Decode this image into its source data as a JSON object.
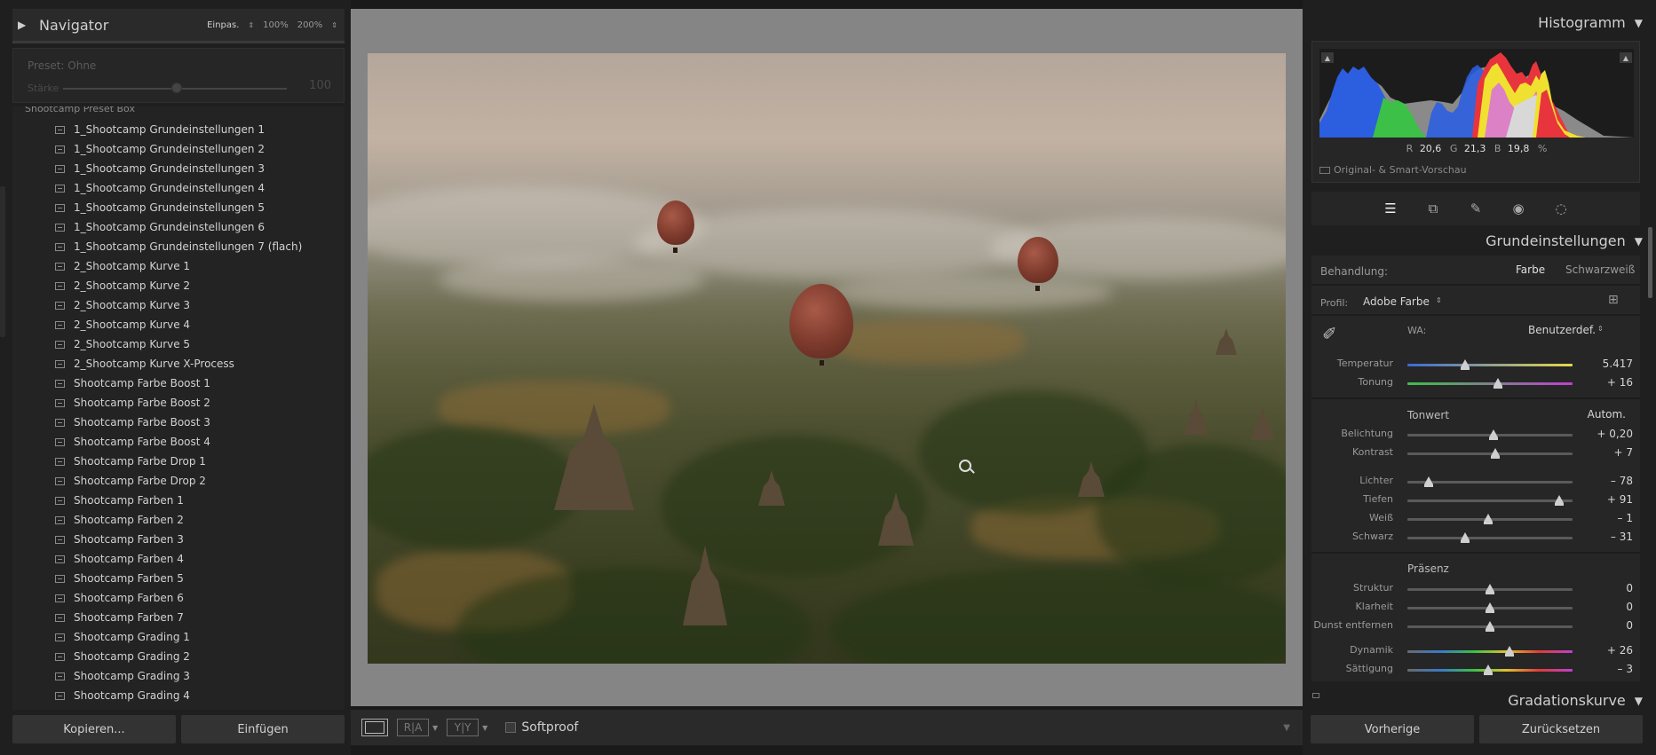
{
  "navigator": {
    "title": "Navigator",
    "zoom_options": [
      "Einpas.",
      "100%",
      "200%"
    ]
  },
  "preset_box": {
    "preset_label": "Preset: Ohne",
    "strength_label": "Stärke",
    "strength_value": "100"
  },
  "presets": {
    "folder": "Shootcamp Preset Box",
    "items": [
      "1_Shootcamp Grundeinstellungen 1",
      "1_Shootcamp Grundeinstellungen 2",
      "1_Shootcamp Grundeinstellungen 3",
      "1_Shootcamp Grundeinstellungen 4",
      "1_Shootcamp Grundeinstellungen 5",
      "1_Shootcamp Grundeinstellungen 6",
      "1_Shootcamp Grundeinstellungen 7 (flach)",
      "2_Shootcamp Kurve 1",
      "2_Shootcamp Kurve 2",
      "2_Shootcamp Kurve 3",
      "2_Shootcamp Kurve 4",
      "2_Shootcamp Kurve 5",
      "2_Shootcamp Kurve X-Process",
      "Shootcamp Farbe Boost 1",
      "Shootcamp Farbe Boost 2",
      "Shootcamp Farbe Boost 3",
      "Shootcamp Farbe Boost 4",
      "Shootcamp Farbe Drop 1",
      "Shootcamp Farbe Drop 2",
      "Shootcamp Farben 1",
      "Shootcamp Farben 2",
      "Shootcamp Farben 3",
      "Shootcamp Farben 4",
      "Shootcamp Farben 5",
      "Shootcamp Farben 6",
      "Shootcamp Farben 7",
      "Shootcamp Grading 1",
      "Shootcamp Grading 2",
      "Shootcamp Grading 3",
      "Shootcamp Grading 4"
    ]
  },
  "left_buttons": {
    "copy": "Kopieren...",
    "paste": "Einfügen"
  },
  "toolbar": {
    "ra_label": "R|A",
    "yy_label": "Y|Y",
    "softproof": "Softproof"
  },
  "histogram": {
    "title": "Histogramm",
    "r_label": "R",
    "r_value": "20,6",
    "g_label": "G",
    "g_value": "21,3",
    "b_label": "B",
    "b_value": "19,8",
    "unit": "%",
    "preview_label": "Original- & Smart-Vorschau"
  },
  "basic": {
    "title": "Grundeinstellungen",
    "treatment_label": "Behandlung:",
    "treatment_color": "Farbe",
    "treatment_bw": "Schwarzweiß",
    "profile_label": "Profil:",
    "profile_value": "Adobe Farbe",
    "wb_label": "WA:",
    "wb_value": "Benutzerdef.",
    "tone_section": "Tonwert",
    "auto_label": "Autom.",
    "presence_section": "Präsenz",
    "sliders": [
      {
        "name": "temperatur",
        "label": "Temperatur",
        "value": "5.417",
        "pos": 0.35,
        "track": "temp"
      },
      {
        "name": "tonung",
        "label": "Tonung",
        "value": "+ 16",
        "pos": 0.55,
        "track": "tint"
      },
      {
        "name": "belichtung",
        "label": "Belichtung",
        "value": "+ 0,20",
        "pos": 0.52,
        "track": "gray"
      },
      {
        "name": "kontrast",
        "label": "Kontrast",
        "value": "+ 7",
        "pos": 0.53,
        "track": "gray"
      },
      {
        "name": "lichter",
        "label": "Lichter",
        "value": "– 78",
        "pos": 0.13,
        "track": "gray"
      },
      {
        "name": "tiefen",
        "label": "Tiefen",
        "value": "+ 91",
        "pos": 0.92,
        "track": "gray"
      },
      {
        "name": "weiss",
        "label": "Weiß",
        "value": "– 1",
        "pos": 0.49,
        "track": "gray"
      },
      {
        "name": "schwarz",
        "label": "Schwarz",
        "value": "– 31",
        "pos": 0.35,
        "track": "gray"
      },
      {
        "name": "struktur",
        "label": "Struktur",
        "value": "0",
        "pos": 0.5,
        "track": "gray"
      },
      {
        "name": "klarheit",
        "label": "Klarheit",
        "value": "0",
        "pos": 0.5,
        "track": "gray"
      },
      {
        "name": "dunst",
        "label": "Dunst entfernen",
        "value": "0",
        "pos": 0.5,
        "track": "gray"
      },
      {
        "name": "dynamik",
        "label": "Dynamik",
        "value": "+ 26",
        "pos": 0.62,
        "track": "sat"
      },
      {
        "name": "saettigung",
        "label": "Sättigung",
        "value": "– 3",
        "pos": 0.49,
        "track": "sat"
      }
    ]
  },
  "curve": {
    "title": "Gradationskurve"
  },
  "right_buttons": {
    "previous": "Vorherige",
    "reset": "Zurücksetzen"
  },
  "colors": {
    "panel": "#262626",
    "background": "#1f1f1f",
    "canvas": "#858585",
    "histogram_red": "#e8343c",
    "histogram_green": "#3cc048",
    "histogram_blue": "#2c5ee0",
    "histogram_yellow": "#f0e030"
  }
}
